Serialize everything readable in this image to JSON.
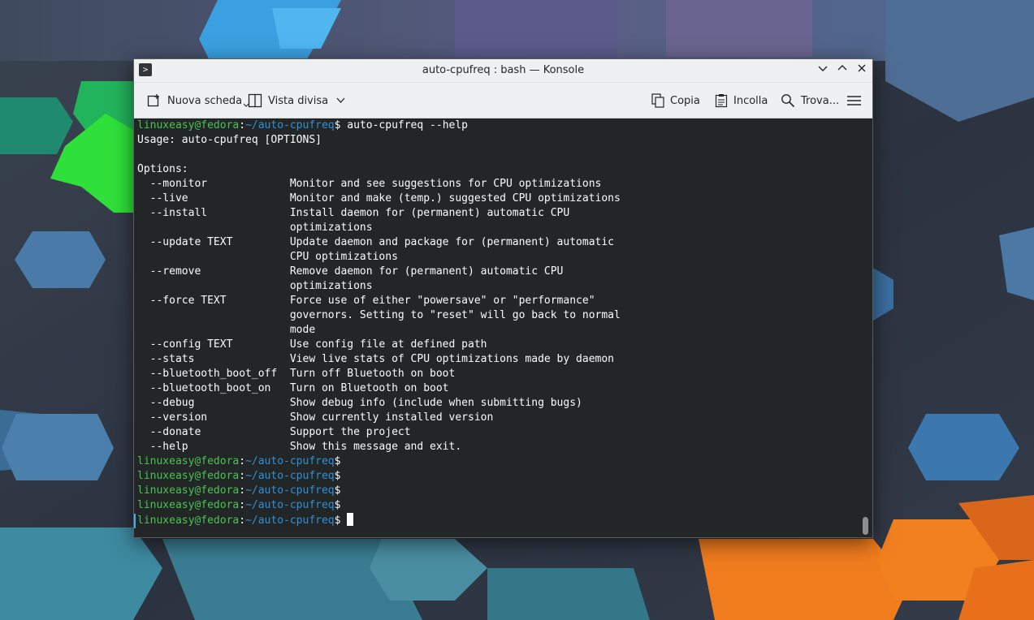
{
  "window": {
    "title": "auto-cpufreq : bash — Konsole",
    "app_icon": ">"
  },
  "window_buttons": [
    "chevron-down-icon",
    "chevron-up-icon",
    "close-icon"
  ],
  "toolbar": {
    "new_tab_label": "Nuova scheda",
    "split_view_label": "Vista divisa",
    "copy_label": "Copia",
    "paste_label": "Incolla",
    "find_label": "Trova..."
  },
  "prompt": {
    "user_host": "linuxeasy@fedora",
    "colon": ":",
    "path": "~/auto-cpufreq",
    "symbol": "$"
  },
  "terminal": {
    "command": " auto-cpufreq --help",
    "output": [
      "Usage: auto-cpufreq [OPTIONS]",
      "",
      "Options:",
      "  --monitor             Monitor and see suggestions for CPU optimizations",
      "  --live                Monitor and make (temp.) suggested CPU optimizations",
      "  --install             Install daemon for (permanent) automatic CPU",
      "                        optimizations",
      "  --update TEXT         Update daemon and package for (permanent) automatic",
      "                        CPU optimizations",
      "  --remove              Remove daemon for (permanent) automatic CPU",
      "                        optimizations",
      "  --force TEXT          Force use of either \"powersave\" or \"performance\"",
      "                        governors. Setting to \"reset\" will go back to normal",
      "                        mode",
      "  --config TEXT         Use config file at defined path",
      "  --stats               View live stats of CPU optimizations made by daemon",
      "  --bluetooth_boot_off  Turn off Bluetooth on boot",
      "  --bluetooth_boot_on   Turn on Bluetooth on boot",
      "  --debug               Show debug info (include when submitting bugs)",
      "  --version             Show currently installed version",
      "  --donate              Support the project",
      "  --help                Show this message and exit."
    ],
    "empty_prompts": 5
  }
}
